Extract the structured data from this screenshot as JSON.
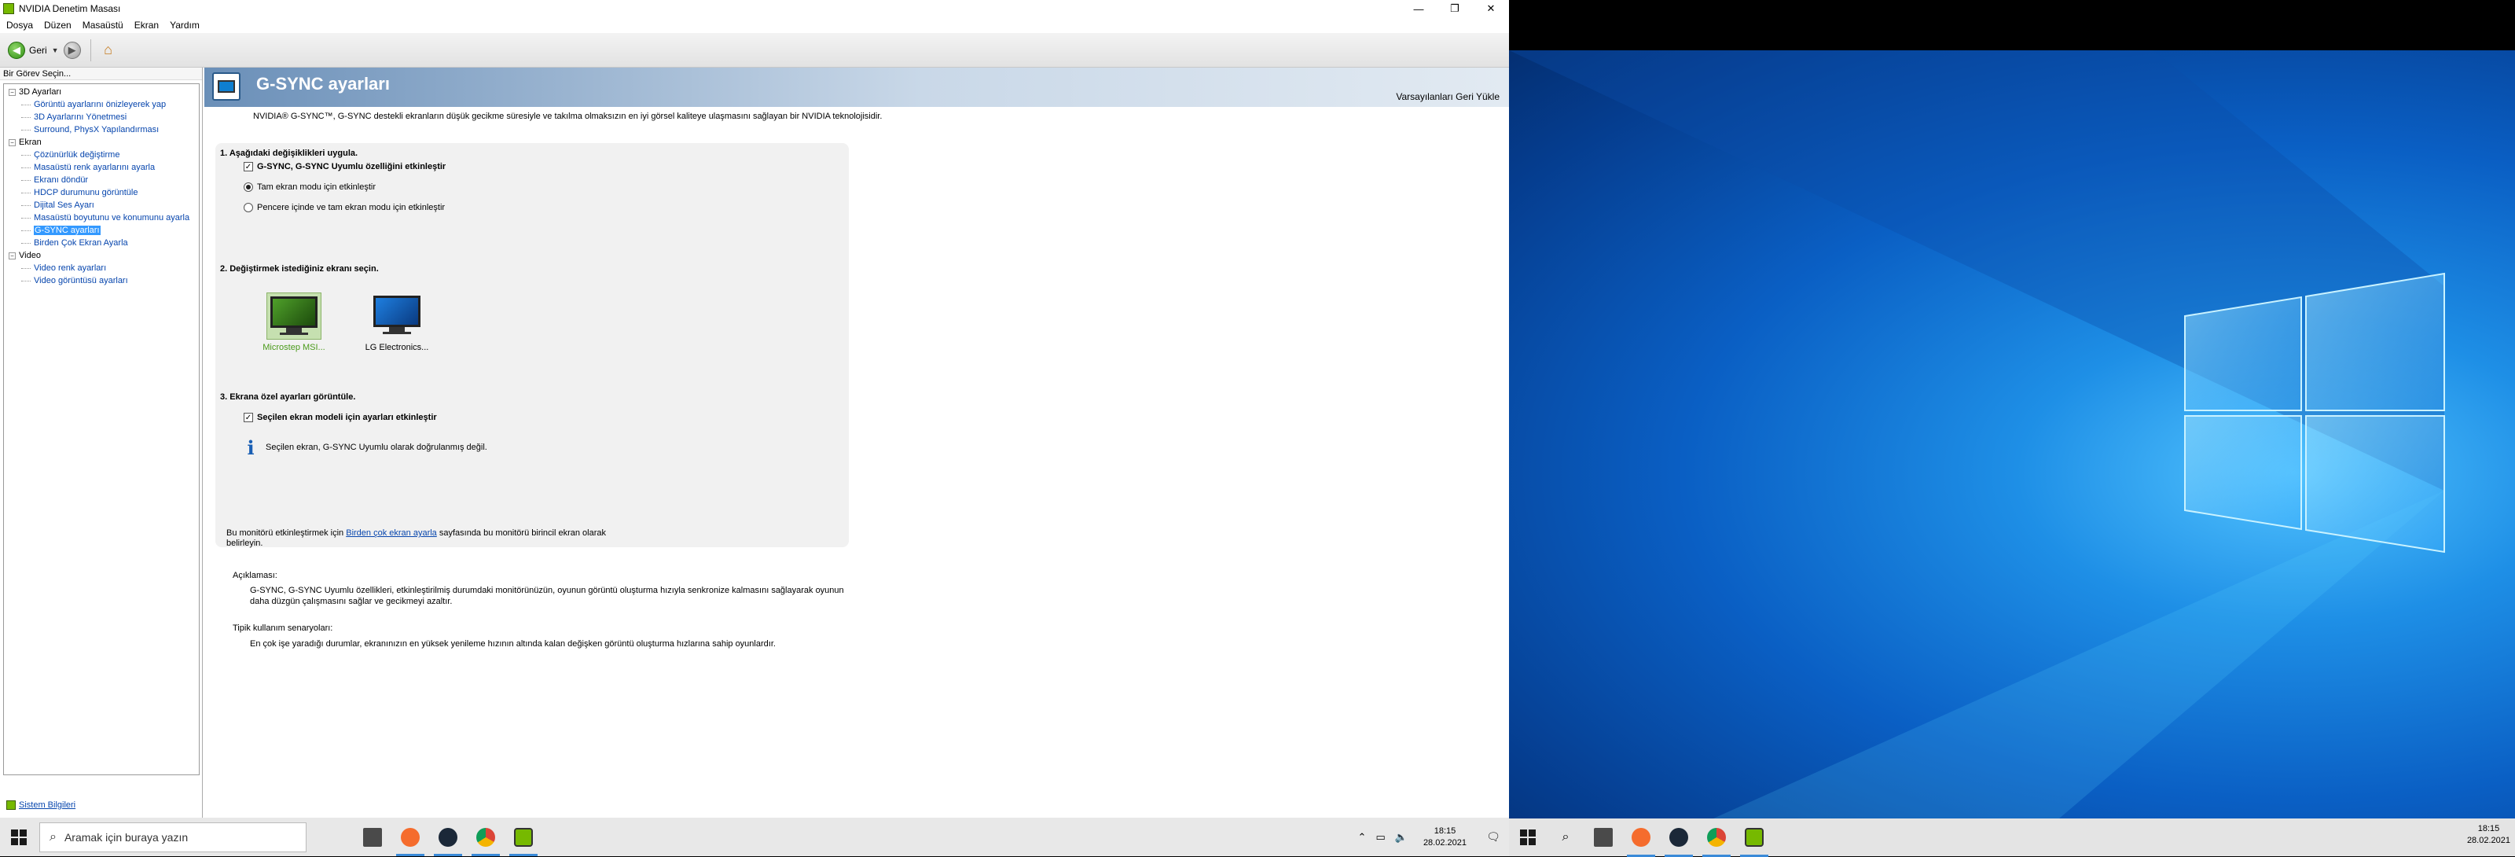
{
  "window": {
    "title": "NVIDIA Denetim Masası"
  },
  "menu": [
    "Dosya",
    "Düzen",
    "Masaüstü",
    "Ekran",
    "Yardım"
  ],
  "toolbar": {
    "back_label": "Geri"
  },
  "task_panel": {
    "header": "Bir Görev Seçin...",
    "categories": [
      {
        "label": "3D Ayarları",
        "items": [
          "Görüntü ayarlarını önizleyerek yap",
          "3D Ayarlarını Yönetmesi",
          "Surround, PhysX Yapılandırması"
        ]
      },
      {
        "label": "Ekran",
        "items": [
          "Çözünürlük değiştirme",
          "Masaüstü renk ayarlarını ayarla",
          "Ekranı döndür",
          "HDCP durumunu görüntüle",
          "Dijital Ses Ayarı",
          "Masaüstü boyutunu ve konumunu ayarla",
          "G-SYNC ayarları",
          "Birden Çok Ekran Ayarla"
        ]
      },
      {
        "label": "Video",
        "items": [
          "Video renk ayarları",
          "Video görüntüsü ayarları"
        ]
      }
    ],
    "selected": "G-SYNC ayarları",
    "system_info": "Sistem Bilgileri"
  },
  "page": {
    "title": "G-SYNC ayarları",
    "restore_defaults": "Varsayılanları Geri Yükle",
    "intro": "NVIDIA® G-SYNC™, G-SYNC destekli ekranların düşük gecikme süresiyle ve takılma olmaksızın en iyi görsel kaliteye ulaşmasını sağlayan bir NVIDIA teknolojisidir.",
    "step1": {
      "heading": "1. Aşağıdaki değişiklikleri uygula.",
      "enable_gsync": "G-SYNC, G-SYNC Uyumlu özelliğini etkinleştir",
      "enable_gsync_checked": true,
      "radio_fullscreen": "Tam ekran modu için etkinleştir",
      "radio_windowed": "Pencere içinde ve tam ekran modu için etkinleştir",
      "selected_radio": "fullscreen"
    },
    "step2": {
      "heading": "2. Değiştirmek istediğiniz ekranı seçin.",
      "monitors": [
        {
          "label": "Microstep MSI...",
          "selected": true
        },
        {
          "label": "LG Electronics...",
          "selected": false
        }
      ]
    },
    "step3": {
      "heading": "3. Ekrana özel ayarları görüntüle.",
      "enable_model": "Seçilen ekran modeli için ayarları etkinleştir",
      "enable_model_checked": true,
      "info": "Seçilen ekran, G-SYNC Uyumlu olarak doğrulanmış değil."
    },
    "note_prefix": "Bu monitörü etkinleştirmek için ",
    "note_link": "Birden çok ekran ayarla",
    "note_suffix": " sayfasında bu monitörü birincil ekran olarak belirleyin.",
    "description_label": "Açıklaması:",
    "description_text": "G-SYNC, G-SYNC Uyumlu özellikleri, etkinleştirilmiş durumdaki monitörünüzün, oyunun görüntü oluşturma hızıyla senkronize kalmasını sağlayarak oyunun daha düzgün çalışmasını sağlar ve gecikmeyi azaltır.",
    "scenarios_label": "Tipik kullanım senaryoları:",
    "scenarios_text": "En çok işe yaradığı durumlar, ekranınızın en yüksek yenileme hızının altında kalan değişken görüntü oluşturma hızlarına sahip oyunlardır."
  },
  "taskbar": {
    "search_placeholder": "Aramak için buraya yazın",
    "apps": [
      "store",
      "origin",
      "steam",
      "chrome",
      "nvidia"
    ],
    "time": "18:15",
    "date": "28.02.2021"
  },
  "right_taskbar": {
    "time": "18:15",
    "date": "28.02.2021"
  }
}
